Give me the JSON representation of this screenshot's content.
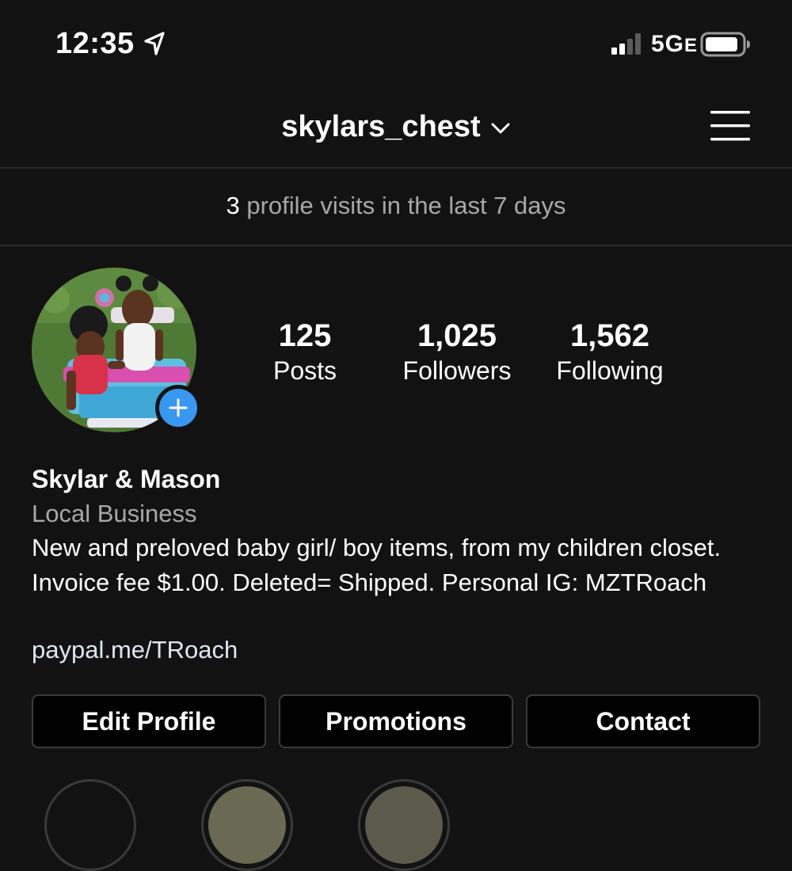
{
  "status_bar": {
    "time": "12:35",
    "network": "5G",
    "network_suffix": "E",
    "icons": [
      "location-arrow-icon",
      "cellular-signal-icon",
      "battery-icon"
    ]
  },
  "header": {
    "username": "skylars_chest",
    "icons": [
      "chevron-down-icon",
      "hamburger-menu-icon"
    ]
  },
  "insights": {
    "count": "3",
    "text": " profile visits in the last 7 days"
  },
  "profile": {
    "avatar_icon": "profile-photo",
    "add_icon": "plus-icon"
  },
  "stats": {
    "posts_value": "125",
    "posts_label": "Posts",
    "followers_value": "1,025",
    "followers_label": "Followers",
    "following_value": "1,562",
    "following_label": "Following"
  },
  "bio": {
    "name": "Skylar & Mason",
    "category": "Local Business",
    "text": "New and preloved baby girl/ boy items, from my children closet. Invoice fee $1.00. Deleted= Shipped. Personal IG: MZTRoach",
    "link": "paypal.me/TRoach"
  },
  "actions": {
    "edit_profile": "Edit Profile",
    "promotions": "Promotions",
    "contact": "Contact"
  },
  "colors": {
    "background": "#121212",
    "accent_blue": "#3897f0",
    "secondary_text": "#a8a8a8",
    "button_border": "#3a3a3a"
  }
}
